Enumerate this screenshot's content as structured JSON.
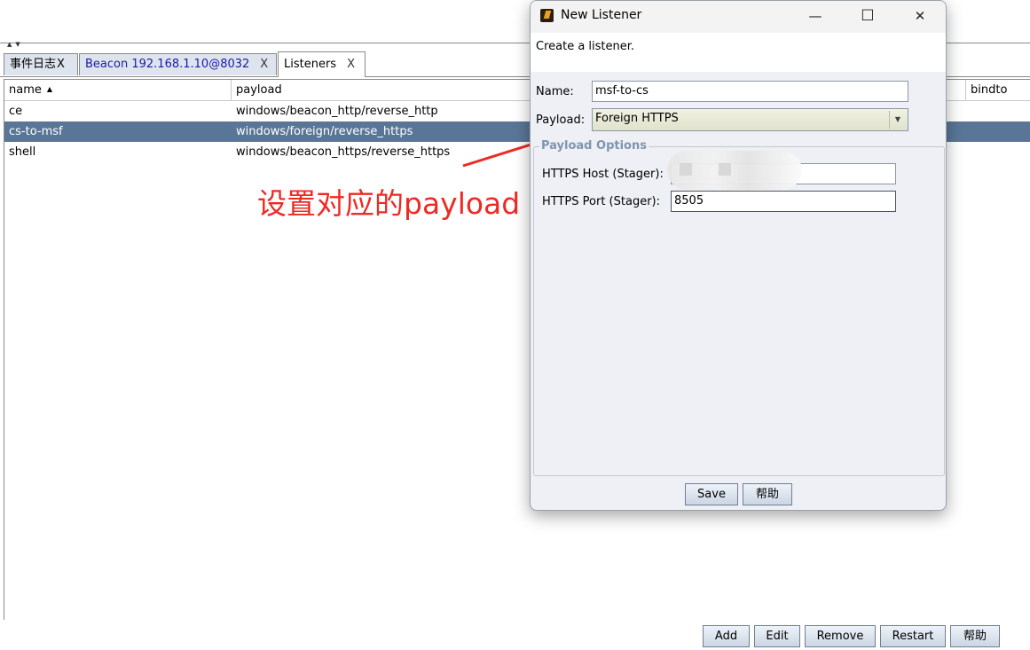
{
  "tabs": [
    {
      "label": "事件日志",
      "close": "X"
    },
    {
      "label": "Beacon 192.168.1.10@8032",
      "close": "X"
    },
    {
      "label": "Listeners",
      "close": "X"
    }
  ],
  "table": {
    "columns": [
      "name",
      "payload",
      "bindto"
    ],
    "rows": [
      {
        "name": "ce",
        "payload": "windows/beacon_http/reverse_http"
      },
      {
        "name": "cs-to-msf",
        "payload": "windows/foreign/reverse_https"
      },
      {
        "name": "shell",
        "payload": "windows/beacon_https/reverse_https"
      }
    ],
    "selected_row": "cs-to-msf"
  },
  "buttons": {
    "add": "Add",
    "edit": "Edit",
    "remove": "Remove",
    "restart": "Restart",
    "help": "帮助"
  },
  "annotation": {
    "text": "设置对应的payload",
    "color": "#ee2a24"
  },
  "dialog": {
    "title": "New Listener",
    "minimize": "—",
    "maximize": "☐",
    "close": "✕",
    "header": "Create a listener.",
    "name_label": "Name:",
    "name_value": "msf-to-cs",
    "payload_label": "Payload:",
    "payload_value": "Foreign HTTPS",
    "options_title": "Payload Options",
    "host_label": "HTTPS Host (Stager):",
    "host_value": "",
    "port_label": "HTTPS Port (Stager):",
    "port_value": "8505",
    "save": "Save",
    "help": "帮助"
  },
  "colors": {
    "selection": "#5a7697",
    "accent_blue": "#1a1aa6"
  }
}
